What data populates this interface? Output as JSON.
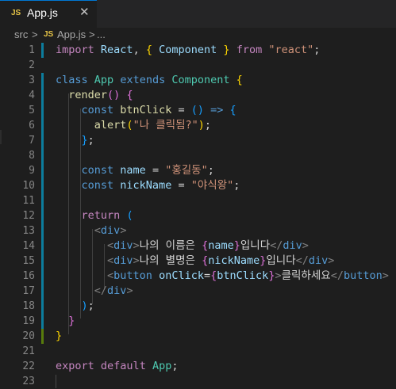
{
  "tab": {
    "icon_label": "JS",
    "filename": "App.js",
    "close_glyph": "✕"
  },
  "breadcrumb": {
    "folder": "src",
    "separator": ">",
    "icon_label": "JS",
    "file": "App.js",
    "ellipsis": "..."
  },
  "colors": {
    "modified_bar": "#0c7d9d",
    "added_bar": "#587c0c",
    "keyword": "#569cd6",
    "control": "#c586c0",
    "string": "#ce9178",
    "type": "#4ec9b0",
    "variable": "#9cdcfe",
    "function": "#dcdcaa"
  },
  "lines": [
    {
      "n": "1",
      "bar": "modified",
      "tokens": [
        [
          "import",
          "kw2"
        ],
        [
          " ",
          ""
        ],
        [
          "React",
          "id"
        ],
        [
          ", ",
          ""
        ],
        [
          "{",
          "br1"
        ],
        [
          " ",
          ""
        ],
        [
          "Component",
          "id"
        ],
        [
          " ",
          ""
        ],
        [
          "}",
          "br1"
        ],
        [
          " ",
          ""
        ],
        [
          "from",
          "kw2"
        ],
        [
          " ",
          ""
        ],
        [
          "\"react\"",
          "str"
        ],
        [
          ";",
          ""
        ]
      ]
    },
    {
      "n": "2",
      "bar": "none",
      "tokens": []
    },
    {
      "n": "3",
      "bar": "modified",
      "tokens": [
        [
          "class",
          "kw"
        ],
        [
          " ",
          ""
        ],
        [
          "App",
          "cls"
        ],
        [
          " ",
          ""
        ],
        [
          "extends",
          "kw"
        ],
        [
          " ",
          ""
        ],
        [
          "Component",
          "cls"
        ],
        [
          " ",
          ""
        ],
        [
          "{",
          "br1"
        ]
      ]
    },
    {
      "n": "4",
      "bar": "modified",
      "tokens": [
        [
          "  ",
          ""
        ],
        [
          "render",
          "fn"
        ],
        [
          "()",
          "br2"
        ],
        [
          " ",
          ""
        ],
        [
          "{",
          "br2"
        ]
      ]
    },
    {
      "n": "5",
      "bar": "modified",
      "tokens": [
        [
          "    ",
          ""
        ],
        [
          "const",
          "kw"
        ],
        [
          " ",
          ""
        ],
        [
          "btnClick",
          "fn"
        ],
        [
          " = ",
          ""
        ],
        [
          "()",
          "br3"
        ],
        [
          " ",
          ""
        ],
        [
          "=>",
          "kw"
        ],
        [
          " ",
          ""
        ],
        [
          "{",
          "br3"
        ]
      ]
    },
    {
      "n": "6",
      "bar": "modified",
      "tokens": [
        [
          "      ",
          ""
        ],
        [
          "alert",
          "fn"
        ],
        [
          "(",
          "br1"
        ],
        [
          "\"나 클릭됨?\"",
          "str"
        ],
        [
          ")",
          "br1"
        ],
        [
          ";",
          ""
        ]
      ]
    },
    {
      "n": "7",
      "bar": "modified",
      "tokens": [
        [
          "    ",
          ""
        ],
        [
          "}",
          "br3"
        ],
        [
          ";",
          ""
        ]
      ]
    },
    {
      "n": "8",
      "bar": "modified",
      "tokens": []
    },
    {
      "n": "9",
      "bar": "modified",
      "tokens": [
        [
          "    ",
          ""
        ],
        [
          "const",
          "kw"
        ],
        [
          " ",
          ""
        ],
        [
          "name",
          "id"
        ],
        [
          " = ",
          ""
        ],
        [
          "\"홍길동\"",
          "str"
        ],
        [
          ";",
          ""
        ]
      ]
    },
    {
      "n": "10",
      "bar": "modified",
      "tokens": [
        [
          "    ",
          ""
        ],
        [
          "const",
          "kw"
        ],
        [
          " ",
          ""
        ],
        [
          "nickName",
          "id"
        ],
        [
          " = ",
          ""
        ],
        [
          "\"야식왕\"",
          "str"
        ],
        [
          ";",
          ""
        ]
      ]
    },
    {
      "n": "11",
      "bar": "modified",
      "tokens": []
    },
    {
      "n": "12",
      "bar": "modified",
      "tokens": [
        [
          "    ",
          ""
        ],
        [
          "return",
          "kw2"
        ],
        [
          " ",
          ""
        ],
        [
          "(",
          "br3"
        ]
      ]
    },
    {
      "n": "13",
      "bar": "modified",
      "tokens": [
        [
          "      ",
          ""
        ],
        [
          "<",
          "tag"
        ],
        [
          "div",
          "tname"
        ],
        [
          ">",
          "tag"
        ]
      ]
    },
    {
      "n": "14",
      "bar": "modified",
      "tokens": [
        [
          "        ",
          ""
        ],
        [
          "<",
          "tag"
        ],
        [
          "div",
          "tname"
        ],
        [
          ">",
          "tag"
        ],
        [
          "나의 이름은 ",
          "txt"
        ],
        [
          "{",
          "br2"
        ],
        [
          "name",
          "id"
        ],
        [
          "}",
          "br2"
        ],
        [
          "입니다",
          "txt"
        ],
        [
          "</",
          "tag"
        ],
        [
          "div",
          "tname"
        ],
        [
          ">",
          "tag"
        ]
      ]
    },
    {
      "n": "15",
      "bar": "modified",
      "tokens": [
        [
          "        ",
          ""
        ],
        [
          "<",
          "tag"
        ],
        [
          "div",
          "tname"
        ],
        [
          ">",
          "tag"
        ],
        [
          "나의 별명은 ",
          "txt"
        ],
        [
          "{",
          "br2"
        ],
        [
          "nickName",
          "id"
        ],
        [
          "}",
          "br2"
        ],
        [
          "입니다",
          "txt"
        ],
        [
          "</",
          "tag"
        ],
        [
          "div",
          "tname"
        ],
        [
          ">",
          "tag"
        ]
      ]
    },
    {
      "n": "16",
      "bar": "modified",
      "tokens": [
        [
          "        ",
          ""
        ],
        [
          "<",
          "tag"
        ],
        [
          "button",
          "tname"
        ],
        [
          " ",
          ""
        ],
        [
          "onClick",
          "attr"
        ],
        [
          "=",
          ""
        ],
        [
          "{",
          "br2"
        ],
        [
          "btnClick",
          "id"
        ],
        [
          "}",
          "br2"
        ],
        [
          ">",
          "tag"
        ],
        [
          "클릭하세요",
          "txt"
        ],
        [
          "</",
          "tag"
        ],
        [
          "button",
          "tname"
        ],
        [
          ">",
          "tag"
        ]
      ]
    },
    {
      "n": "17",
      "bar": "modified",
      "tokens": [
        [
          "      ",
          ""
        ],
        [
          "</",
          "tag"
        ],
        [
          "div",
          "tname"
        ],
        [
          ">",
          "tag"
        ]
      ]
    },
    {
      "n": "18",
      "bar": "modified",
      "tokens": [
        [
          "    ",
          ""
        ],
        [
          ")",
          "br3"
        ],
        [
          ";",
          ""
        ]
      ]
    },
    {
      "n": "19",
      "bar": "modified",
      "tokens": [
        [
          "  ",
          ""
        ],
        [
          "}",
          "br2"
        ]
      ]
    },
    {
      "n": "20",
      "bar": "added",
      "tokens": [
        [
          "}",
          "br1"
        ]
      ]
    },
    {
      "n": "21",
      "bar": "none",
      "tokens": []
    },
    {
      "n": "22",
      "bar": "none",
      "tokens": [
        [
          "export",
          "kw2"
        ],
        [
          " ",
          ""
        ],
        [
          "default",
          "kw2"
        ],
        [
          " ",
          ""
        ],
        [
          "App",
          "cls"
        ],
        [
          ";",
          ""
        ]
      ]
    },
    {
      "n": "23",
      "bar": "none",
      "tokens": []
    }
  ]
}
